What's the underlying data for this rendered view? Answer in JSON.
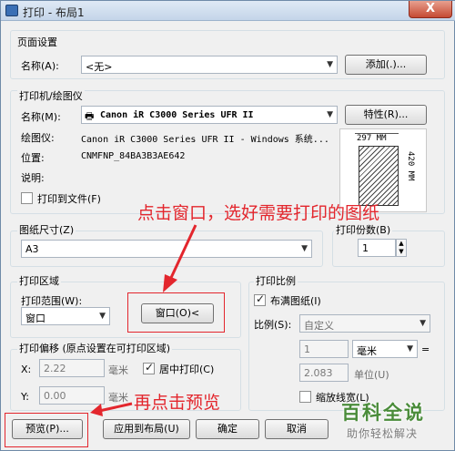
{
  "window": {
    "title": "打印 - 布局1",
    "close": "X"
  },
  "page_setup": {
    "group": "页面设置",
    "name_label": "名称(A):",
    "name_value": "<无>",
    "add_button": "添加(.)..."
  },
  "printer": {
    "group": "打印机/绘图仪",
    "name_label": "名称(M):",
    "name_value": "Canon iR C3000 Series UFR II",
    "properties_button": "特性(R)...",
    "plotter_label": "绘图仪:",
    "plotter_value": "Canon iR C3000 Series UFR II - Windows 系统...",
    "location_label": "位置:",
    "location_value": "CNMFNP_84BA3B3AE642",
    "description_label": "说明:",
    "print_to_file": "打印到文件(F)",
    "preview_width": "297 MM",
    "preview_height": "420 MM"
  },
  "paper": {
    "group": "图纸尺寸(Z)",
    "value": "A3",
    "copies_label": "打印份数(B)",
    "copies_value": "1"
  },
  "area": {
    "group": "打印区域",
    "range_label": "打印范围(W):",
    "range_value": "窗口",
    "window_button": "窗口(O)<"
  },
  "offset": {
    "group": "打印偏移 (原点设置在可打印区域)",
    "x_label": "X:",
    "x_value": "2.22",
    "x_unit": "毫米",
    "y_label": "Y:",
    "y_value": "0.00",
    "y_unit": "毫米",
    "center": "居中打印(C)"
  },
  "scale": {
    "group": "打印比例",
    "fit": "布满图纸(I)",
    "ratio_label": "比例(S):",
    "ratio_value": "自定义",
    "value1": "1",
    "unit_value": "毫米",
    "eq": "=",
    "value2": "2.083",
    "unit_label": "单位(U)",
    "lineweights": "缩放线宽(L)"
  },
  "buttons": {
    "preview": "预览(P)...",
    "apply": "应用到布局(U)",
    "ok": "确定",
    "cancel": "取消"
  },
  "annotations": {
    "top": "点击窗口，选好需要打印的图纸",
    "bottom": "再点击预览"
  },
  "watermark": {
    "title": "百科全说",
    "subtitle": "助你轻松解决"
  },
  "colors": {
    "annotation_red": "#e3262d",
    "title_blue": "#3a6fb5"
  }
}
